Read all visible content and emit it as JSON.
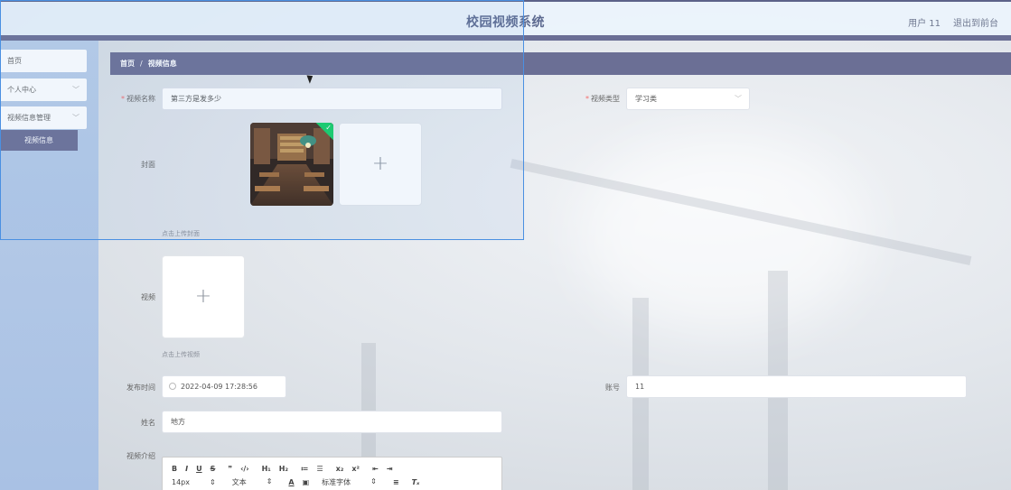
{
  "header": {
    "title": "校园视频系统",
    "user_label": "用户 11",
    "exit_label": "退出到前台"
  },
  "sidebar": {
    "items": [
      {
        "label": "首页"
      },
      {
        "label": "个人中心"
      },
      {
        "label": "视频信息管理"
      }
    ],
    "sub_item": "视频信息"
  },
  "breadcrumb": {
    "home": "首页",
    "separator": "/",
    "current": "视频信息"
  },
  "form": {
    "video_name": {
      "label": "视频名称",
      "value": "第三方是发多少"
    },
    "video_type": {
      "label": "视频类型",
      "value": "学习类"
    },
    "cover": {
      "label": "封面",
      "hint": "点击上传封面"
    },
    "video": {
      "label": "视频",
      "hint": "点击上传视频"
    },
    "publish_time": {
      "label": "发布时间",
      "value": "2022-04-09 17:28:56"
    },
    "account": {
      "label": "账号",
      "value": "11"
    },
    "name": {
      "label": "姓名",
      "value": "地方"
    },
    "intro": {
      "label": "视频介绍"
    }
  },
  "editor": {
    "font_size": "14px",
    "heading_select": "文本",
    "font_select": "标准字体"
  },
  "colors": {
    "accent": "#6b6f95",
    "sidebar": "#b9cde8",
    "required": "#f56c6c",
    "success": "#13ce66"
  }
}
